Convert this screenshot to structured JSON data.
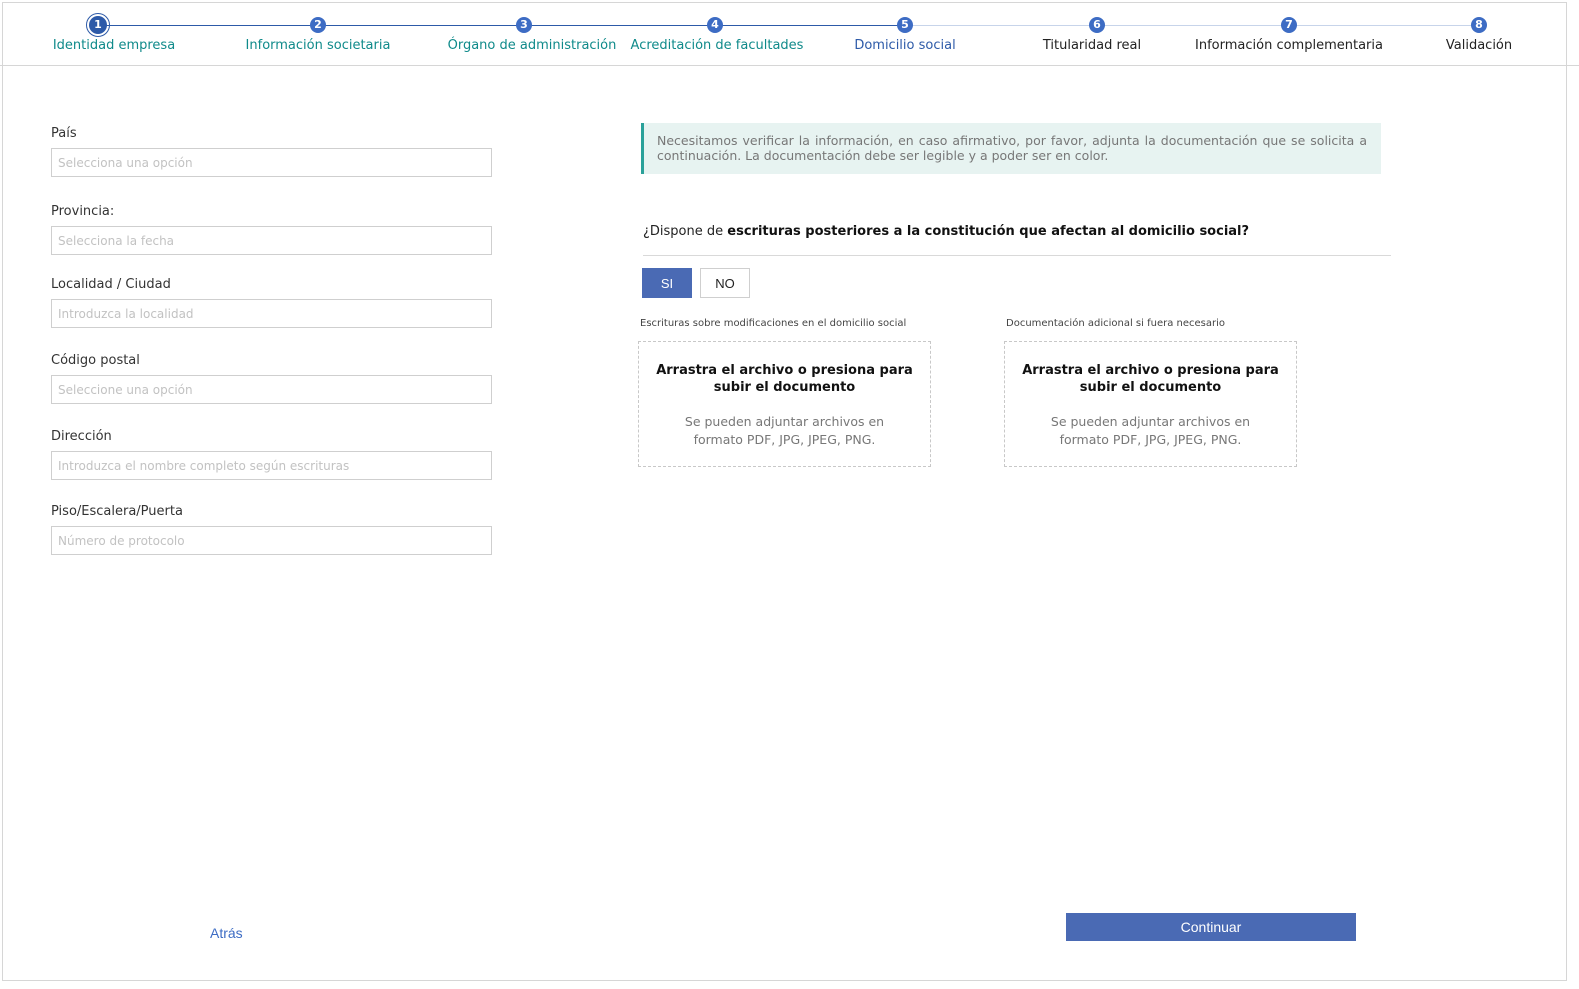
{
  "stepper": {
    "steps": [
      {
        "number": "1",
        "label": "Identidad empresa",
        "state": "current-start"
      },
      {
        "number": "2",
        "label": "Información societaria",
        "state": "done"
      },
      {
        "number": "3",
        "label": "Órgano de administración",
        "state": "done"
      },
      {
        "number": "4",
        "label": "Acreditación de facultades",
        "state": "done"
      },
      {
        "number": "5",
        "label": "Domicilio social",
        "state": "current"
      },
      {
        "number": "6",
        "label": "Titularidad real",
        "state": "todo"
      },
      {
        "number": "7",
        "label": "Información complementaria",
        "state": "todo"
      },
      {
        "number": "8",
        "label": "Validación",
        "state": "todo"
      }
    ]
  },
  "form": {
    "pais": {
      "label": "País",
      "placeholder": "Selecciona una opción"
    },
    "provincia": {
      "label": "Provincia:",
      "placeholder": "Selecciona la fecha"
    },
    "localidad": {
      "label": "Localidad / Ciudad",
      "placeholder": "Introduzca la localidad"
    },
    "codigo_postal": {
      "label": "Código postal",
      "placeholder": "Seleccione una opción"
    },
    "direccion": {
      "label": "Dirección",
      "placeholder": "Introduzca el nombre completo según escrituras"
    },
    "piso": {
      "label": "Piso/Escalera/Puerta",
      "placeholder": "Número de protocolo"
    }
  },
  "info": {
    "text": "Necesitamos verificar la información, en caso afirmativo, por favor, adjunta la documentación que se solicita a continuación. La documentación debe ser legible y a poder ser en color."
  },
  "question": {
    "prefix": "¿Dispone de ",
    "bold": "escrituras posteriores a la constitución que afectan al domicilio social?"
  },
  "toggle": {
    "yes": "SI",
    "no": "NO",
    "selected": "yes"
  },
  "uploads": [
    {
      "caption": "Escrituras  sobre modificaciones  en el domicilio  social",
      "title": "Arrastra el archivo o presiona para subir el documento",
      "hint": "Se pueden adjuntar archivos en formato PDF, JPG, JPEG, PNG."
    },
    {
      "caption": "Documentación  adicional  si fuera necesario",
      "title": "Arrastra el archivo o presiona para subir el documento",
      "hint": "Se pueden adjuntar archivos en formato PDF, JPG, JPEG, PNG."
    }
  ],
  "footer": {
    "back": "Atrás",
    "continue": "Continuar"
  },
  "colors": {
    "primary": "#4a6ab4",
    "teal": "#0f8a8a",
    "info_bg": "#e7f3f1"
  }
}
